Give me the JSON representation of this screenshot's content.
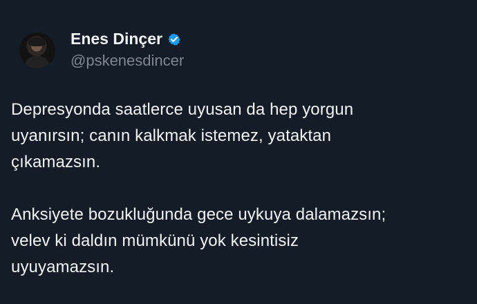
{
  "author": {
    "display_name": "Enes Dinçer",
    "handle": "@pskenesdincer",
    "avatar_icon": "profile-photo",
    "verified_icon": "verified-badge-icon"
  },
  "content": {
    "paragraphs": [
      "Depresyonda saatlerce uyusan da hep yorgun\nuyanırsın; canın kalkmak istemez, yataktan\nçıkamazsın.",
      "Anksiyete bozukluğunda gece uykuya dalamazsın;\nvelev ki daldın mümkünü yok kesintisiz\nuyuyamazsın."
    ]
  },
  "colors": {
    "background": "#141d27",
    "primary_text": "#f2f4f5",
    "secondary_text": "#7d8894",
    "verified_blue": "#1d9bf0"
  }
}
